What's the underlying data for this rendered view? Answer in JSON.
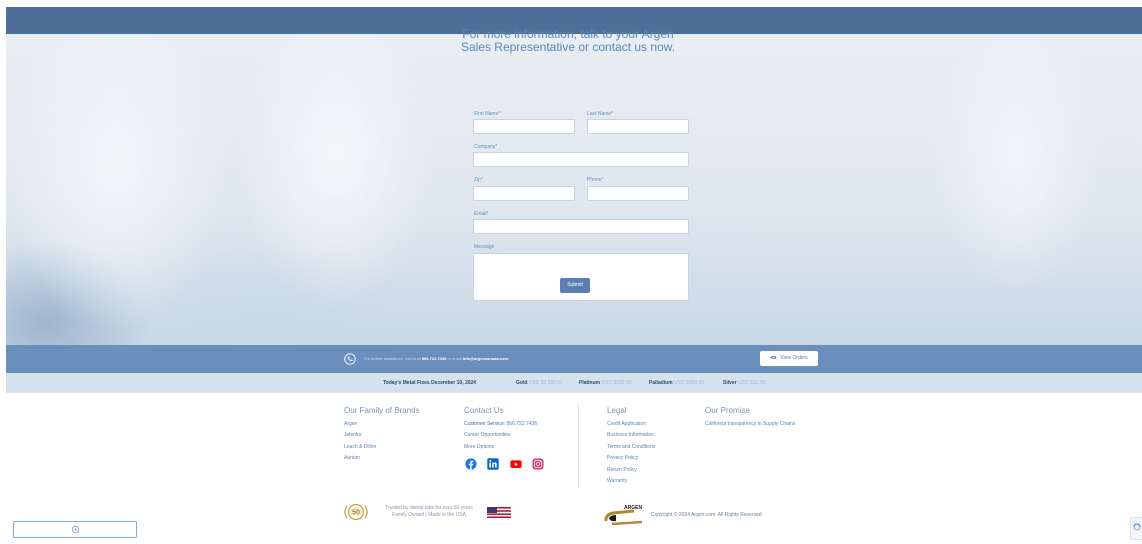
{
  "form": {
    "title_line1": "For more information, talk to your Argen",
    "title_line2": "Sales Representative or contact us now.",
    "first_name_label": "First Name*",
    "last_name_label": "Last Name*",
    "company_label": "Company*",
    "zip_label": "Zip*",
    "phone_label": "Phone*",
    "email_label": "Email*",
    "message_label": "Message",
    "submit_label": "Submit"
  },
  "contact_bar": {
    "assist_text": "For further assistance, call us at",
    "phone": "866.722.7436",
    "or_email": "or email",
    "email": "info@argencanada.com",
    "view_orders_label": "View Orders"
  },
  "metal_fixes": {
    "title": "Today's Metal Fixes December 10, 2024",
    "gold_label": "Gold",
    "gold_value": "USD $2,685.60",
    "platinum_label": "Platinum",
    "platinum_value": "USD $939.00",
    "palladium_label": "Palladium",
    "palladium_value": "USD $969.00",
    "silver_label": "Silver",
    "silver_value": "USD $31.90"
  },
  "footer": {
    "brands_title": "Our Family of Brands",
    "brands": [
      "Argen",
      "Jelenko",
      "Leach & Dillon",
      "Aurium"
    ],
    "contact_title": "Contact Us",
    "customer_service_label": "Customer Service:",
    "customer_service_phone": "866.722.7436",
    "career": "Career Opportunities",
    "more_options": "More Options",
    "legal_title": "Legal",
    "legal": [
      "Credit Application",
      "Business Information",
      "Terms and Conditions",
      "Privacy Policy",
      "Return Policy",
      "Warranty"
    ],
    "promise_title": "Our Promise",
    "promise_link": "California transparency in Supply Chains",
    "trusted_line1": "Trusted by dental labs for over 50 years",
    "trusted_line2": "Family Owned | Made in the USA",
    "badge_text": "50",
    "argen_logo_text": "ARGEN",
    "copyright": "Copyright © 2024 Argen.com. All Rights Reserved"
  },
  "icons": [
    "phone-icon",
    "eye-icon",
    "facebook-icon",
    "linkedin-icon",
    "youtube-icon",
    "instagram-icon",
    "us-flag-icon",
    "settings-icon",
    "recaptcha-icon"
  ],
  "colors": {
    "header_blue": "#4d6f99",
    "contact_bar_blue": "#6b8fbd",
    "metal_bar": "#d6e1ee",
    "link_blue": "#5e82b1"
  }
}
